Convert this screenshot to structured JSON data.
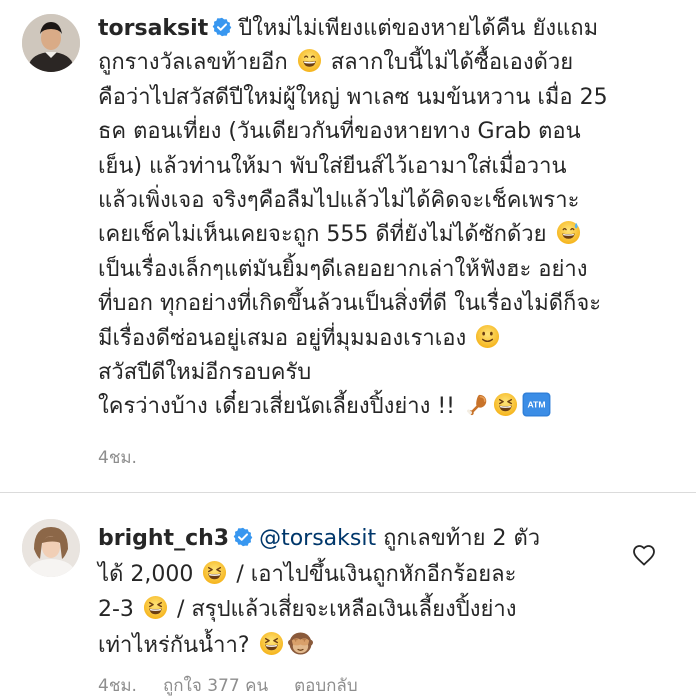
{
  "post": {
    "username": "torsaksit",
    "lines": [
      "ปีใหม่ไม่เพียงแต่ของหายได้คืน ยังแถม",
      "ถูกรางวัลเลขท้ายอีก",
      "สลากใบนี้ไม่ได้ซื้อเองด้วย",
      "คือว่าไปสวัสดีปีใหม่ผู้ใหญ่ พาเลซ นมข้นหวาน เมื่อ 25",
      "ธค ตอนเที่ยง (วันเดียวกันที่ของหายทาง Grab ตอน",
      "เย็น) แล้วท่านให้มา พับใส่ยีนส์ไว้เอามาใส่เมื่อวาน",
      "แล้วเพิ่งเจอ จริงๆคือลืมไปแล้วไม่ได้คิดจะเช็คเพราะ",
      "เคยเช็คไม่เห็นเคยจะถูก 555 ดีที่ยังไม่ได้ซักด้วย",
      "เป็นเรื่องเล็กๆแต่มันยิ้มๆดีเลยอยากเล่าให้ฟังฮะ อย่าง",
      "ที่บอก ทุกอย่างที่เกิดขึ้นล้วนเป็นสิ่งที่ดี ในเรื่องไม่ดีก็จะ",
      "มีเรื่องดีซ่อนอยู่เสมอ อยู่ที่มุมมองเราเอง",
      "สวัสปีดีใหม่อีกรอบครับ",
      "ใครว่างบ้าง เดี๋ยวเสี่ยนัดเลี้ยงปิ้งย่าง !!"
    ],
    "time": "4ชม.",
    "icons": [
      "verified-badge-icon",
      "grinning-emoji",
      "sweat-smile-emoji",
      "slight-smile-emoji",
      "chicken-leg-emoji",
      "laughing-emoji",
      "atm-sign-emoji"
    ]
  },
  "comment": {
    "username": "bright_ch3",
    "mention": "@torsaksit",
    "line1_text": "ถูกเลขท้าย 2 ตัว",
    "line2_text_a": "ได้ 2,000",
    "line2_text_b": "/ เอาไปขึ้นเงินถูกหักอีกร้อยละ",
    "line3_text_a": "2-3",
    "line3_text_b": "/ สรุปแล้วเสี่ยจะเหลือเงินเลี้ยงปิ้งย่าง",
    "line4_text": "เท่าไหร่กันน้ำา?",
    "time": "4ชม.",
    "likes": "ถูกใจ 377 คน",
    "reply": "ตอบกลับ",
    "icons": [
      "verified-badge-icon",
      "laughing-emoji",
      "see-no-evil-monkey-emoji",
      "heart-icon"
    ]
  },
  "colors": {
    "text": "#262626",
    "secondary": "#8e8e8e",
    "verified": "#3897f0",
    "mention": "#00376b",
    "divider": "#dbdbdb"
  }
}
